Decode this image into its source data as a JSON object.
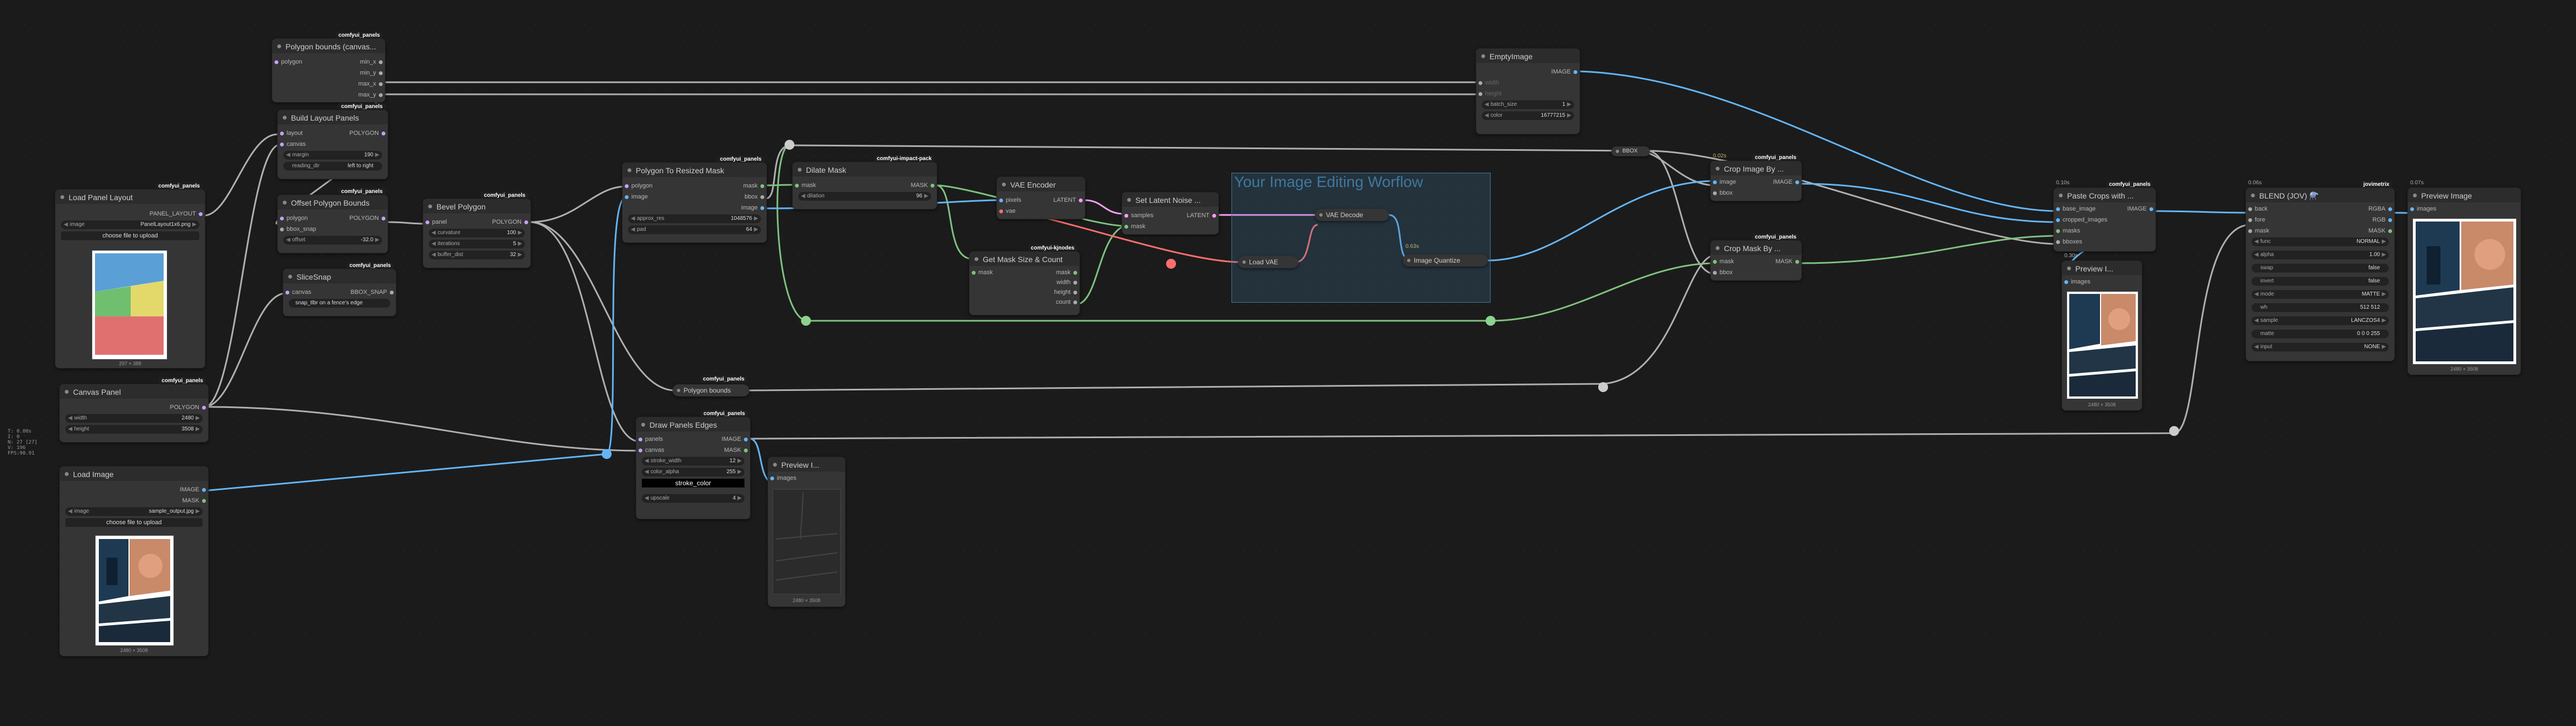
{
  "stats": [
    "T: 0.00s",
    "I: 0",
    "N: 27 [27]",
    "V: 196",
    "FPS:90.91"
  ],
  "group": {
    "title": "Your Image Editing Worflow"
  },
  "wire_labels": {
    "vae_decode_time": "0.63s"
  },
  "nodes": {
    "load_panel_layout": {
      "badge": "comfyui_panels",
      "title": "Load Panel Layout",
      "out": "PANEL_LAYOUT",
      "w_image_label": "image",
      "w_image_value": "PanelLayout1x6.png",
      "upload": "choose file to upload",
      "caption": "297 × 388"
    },
    "polygon_bounds_canvas": {
      "badge": "comfyui_panels",
      "title": "Polygon bounds (canvas...",
      "in": "polygon",
      "outs": [
        "min_x",
        "min_y",
        "max_x",
        "max_y"
      ]
    },
    "build_layout_panels": {
      "badge": "comfyui_panels",
      "title": "Build Layout Panels",
      "ins": [
        "layout",
        "canvas"
      ],
      "out": "POLYGON",
      "w1_label": "margin",
      "w1_value": "190",
      "w2_label": "reading_dir",
      "w2_value": "left to right"
    },
    "offset_polygon_bounds": {
      "badge": "comfyui_panels",
      "title": "Offset Polygon Bounds",
      "ins": [
        "polygon",
        "bbox_snap"
      ],
      "out": "POLYGON",
      "w1_label": "offset",
      "w1_value": "-32.0"
    },
    "slice_snap": {
      "badge": "comfyui_panels",
      "title": "SliceSnap",
      "in": "canvas",
      "out": "BBOX_SNAP",
      "w1_label": "",
      "w1_value": "snap_tlbr on a fence's edge"
    },
    "canvas_panel": {
      "badge": "comfyui_panels",
      "title": "Canvas Panel",
      "out": "POLYGON",
      "w1_label": "width",
      "w1_value": "2480",
      "w2_label": "height",
      "w2_value": "3508"
    },
    "load_image": {
      "title": "Load Image",
      "outs": [
        "IMAGE",
        "MASK"
      ],
      "w_image_label": "image",
      "w_image_value": "sample_output.jpg",
      "upload": "choose file to upload",
      "caption": "2480 × 3508"
    },
    "bevel_polygon": {
      "badge": "comfyui_panels",
      "title": "Bevel Polygon",
      "in": "panel",
      "out": "POLYGON",
      "w1_label": "curvature",
      "w1_value": "100",
      "w2_label": "iterations",
      "w2_value": "5",
      "w3_label": "buffer_dist",
      "w3_value": "32"
    },
    "polygon_to_resized_mask": {
      "badge": "comfyui_panels",
      "title": "Polygon To Resized Mask",
      "ins": [
        "polygon",
        "image"
      ],
      "outs": [
        "mask",
        "bbox",
        "image"
      ],
      "w1_label": "approx_res",
      "w1_value": "1048576",
      "w2_label": "pad",
      "w2_value": "64"
    },
    "dilate_mask": {
      "badge": "comfyui-impact-pack",
      "title": "Dilate Mask",
      "in": "mask",
      "out": "MASK",
      "w1_label": "dilation",
      "w1_value": "96"
    },
    "vae_encode": {
      "title": "VAE Encoder",
      "ins": [
        "pixels",
        "vae"
      ],
      "out": "LATENT"
    },
    "set_latent_noise": {
      "title": "Set Latent Noise ...",
      "ins": [
        "samples",
        "mask"
      ],
      "out": "LATENT"
    },
    "get_mask_size": {
      "badge": "comfyui-kjnodes",
      "title": "Get Mask Size & Count",
      "in": "mask",
      "outs": [
        "mask",
        "width",
        "height",
        "count"
      ]
    },
    "vae_decode": {
      "title": "VAE Decode"
    },
    "load_vae": {
      "title": "Load VAE"
    },
    "image_quantize": {
      "title": "Image Quantize"
    },
    "empty_image": {
      "title": "EmptyImage",
      "outs": [
        "IMAGE"
      ],
      "ins": [
        "width",
        "height"
      ],
      "w1_label": "batch_size",
      "w1_value": "1",
      "w2_label": "color",
      "w2_value": "16777215"
    },
    "bbox_reroute": {
      "title": "BBOX"
    },
    "crop_image_by": {
      "badge": "comfyui_panels",
      "time": "0.02s",
      "title": "Crop Image By ...",
      "ins": [
        "image",
        "bbox"
      ],
      "out": "IMAGE"
    },
    "crop_mask_by": {
      "badge": "comfyui_panels",
      "title": "Crop Mask By ...",
      "ins": [
        "mask",
        "bbox"
      ],
      "out": "MASK"
    },
    "polygon_bounds": {
      "badge": "comfyui_panels",
      "title": "Polygon bounds"
    },
    "draw_panels_edges": {
      "badge": "comfyui_panels",
      "title": "Draw Panels Edges",
      "ins": [
        "panels",
        "canvas"
      ],
      "outs": [
        "IMAGE",
        "MASK"
      ],
      "w1_label": "stroke_width",
      "w1_value": "12",
      "w2_label": "color_alpha",
      "w2_value": "255",
      "w3_value": "stroke_color",
      "w4_label": "upscale",
      "w4_value": "4"
    },
    "preview_image_1": {
      "title": "Preview I...",
      "in": "images",
      "caption": "2480 × 3508"
    },
    "paste_crops": {
      "badge": "comfyui_panels",
      "time": "0.10s",
      "title": "Paste Crops with ...",
      "ins": [
        "base_image",
        "cropped_images",
        "masks",
        "bboxes"
      ],
      "out": "IMAGE"
    },
    "preview_image_2": {
      "time": "0.30s",
      "title": "Preview I...",
      "in": "images",
      "caption": "2480 × 3508"
    },
    "blend": {
      "badge": "jovimetrix",
      "time": "0.06s",
      "title": "BLEND (JOV) ⚗️",
      "ins": [
        "back",
        "fore",
        "mask"
      ],
      "outs": [
        "RGBA",
        "RGB",
        "MASK"
      ],
      "widgets": [
        {
          "l": "func",
          "v": "NORMAL"
        },
        {
          "l": "alpha",
          "v": "1.00"
        },
        {
          "l": "swap",
          "v": "false"
        },
        {
          "l": "invert",
          "v": "false"
        },
        {
          "l": "mode",
          "v": "MATTE"
        },
        {
          "l": "wh",
          "v": "512 512"
        },
        {
          "l": "sample",
          "v": "LANCZOS4"
        },
        {
          "l": "matte",
          "v": "0 0 0 255"
        },
        {
          "l": "input",
          "v": "NONE"
        }
      ]
    },
    "preview_image_3": {
      "time": "0.07s",
      "title": "Preview Image",
      "in": "images",
      "caption": "2480 × 3508"
    }
  }
}
